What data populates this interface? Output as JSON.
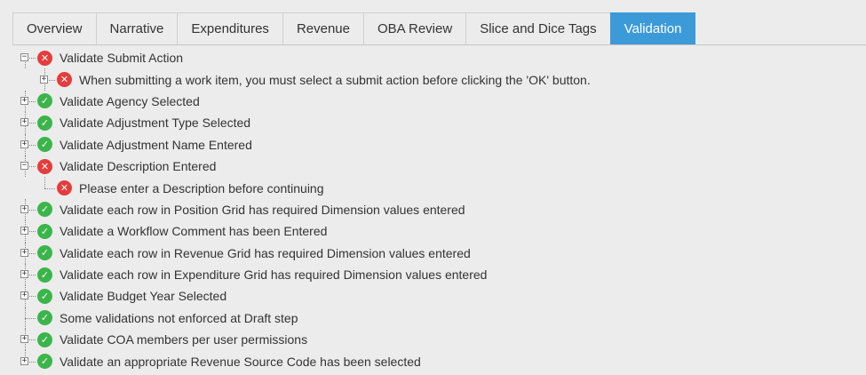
{
  "tabs": [
    {
      "label": "Overview",
      "active": false
    },
    {
      "label": "Narrative",
      "active": false
    },
    {
      "label": "Expenditures",
      "active": false
    },
    {
      "label": "Revenue",
      "active": false
    },
    {
      "label": "OBA Review",
      "active": false
    },
    {
      "label": "Slice and Dice Tags",
      "active": false
    },
    {
      "label": "Validation",
      "active": true
    }
  ],
  "colors": {
    "accent": "#3c9ad9",
    "ok": "#3bb54a",
    "error": "#e53c3c"
  },
  "tree": [
    {
      "label": "Validate Submit Action",
      "status": "error",
      "level": 0,
      "expander": "minus",
      "icon": "error-x-icon"
    },
    {
      "label": "When submitting a work item, you must select a submit action before clicking the 'OK' button.",
      "status": "error",
      "level": 1,
      "expander": "plus",
      "icon": "error-x-icon"
    },
    {
      "label": "Validate Agency Selected",
      "status": "ok",
      "level": 0,
      "expander": "plus",
      "icon": "check-icon"
    },
    {
      "label": "Validate Adjustment Type Selected",
      "status": "ok",
      "level": 0,
      "expander": "plus",
      "icon": "check-icon"
    },
    {
      "label": "Validate Adjustment Name Entered",
      "status": "ok",
      "level": 0,
      "expander": "plus",
      "icon": "check-icon"
    },
    {
      "label": "Validate Description Entered",
      "status": "error",
      "level": 0,
      "expander": "minus",
      "icon": "error-x-icon"
    },
    {
      "label": "Please enter a Description before continuing",
      "status": "error",
      "level": 1,
      "expander": "none",
      "icon": "error-x-icon"
    },
    {
      "label": "Validate each row in Position Grid has required Dimension values entered",
      "status": "ok",
      "level": 0,
      "expander": "plus",
      "icon": "check-icon"
    },
    {
      "label": "Validate a Workflow Comment has been Entered",
      "status": "ok",
      "level": 0,
      "expander": "plus",
      "icon": "check-icon"
    },
    {
      "label": "Validate each row in Revenue Grid has required Dimension values entered",
      "status": "ok",
      "level": 0,
      "expander": "plus",
      "icon": "check-icon"
    },
    {
      "label": "Validate each row in Expenditure Grid has required Dimension values entered",
      "status": "ok",
      "level": 0,
      "expander": "plus",
      "icon": "check-icon"
    },
    {
      "label": "Validate Budget Year Selected",
      "status": "ok",
      "level": 0,
      "expander": "plus",
      "icon": "check-icon"
    },
    {
      "label": "Some validations not enforced at Draft step",
      "status": "ok",
      "level": 0,
      "expander": "none",
      "icon": "check-icon"
    },
    {
      "label": "Validate COA members per user permissions",
      "status": "ok",
      "level": 0,
      "expander": "plus",
      "icon": "check-icon"
    },
    {
      "label": "Validate an appropriate Revenue Source Code has been selected",
      "status": "ok",
      "level": 0,
      "expander": "plus",
      "icon": "check-icon"
    }
  ]
}
